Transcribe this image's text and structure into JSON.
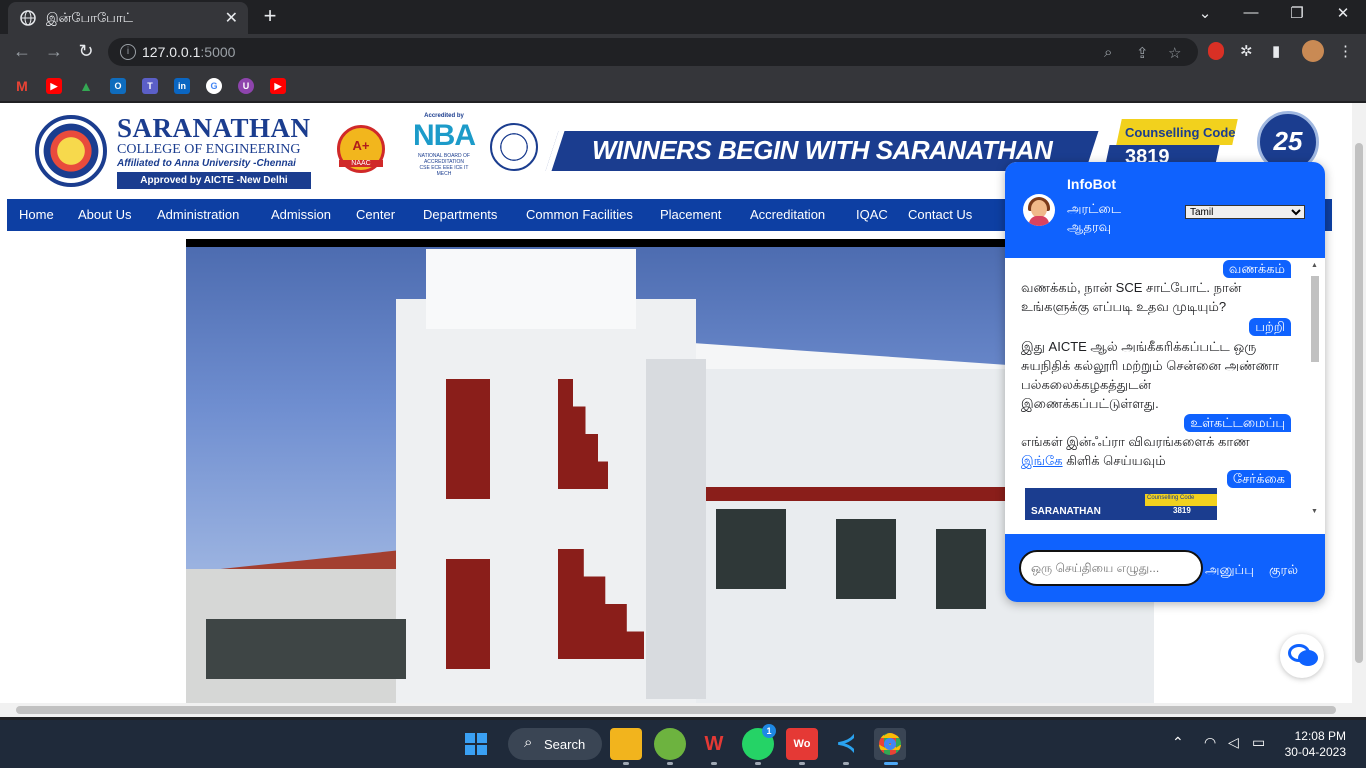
{
  "browser": {
    "tab_title": "இன்போபோட்",
    "close_tab": "✕",
    "new_tab": "+",
    "url_host": "127.0.0.1",
    "url_port": ":5000",
    "min": "⌄",
    "win_min": "—",
    "win_max": "❐",
    "win_close": "✕"
  },
  "site": {
    "college_name_line1": "SARANATHAN",
    "college_name_line2": "COLLEGE OF ENGINEERING",
    "affiliation": "Affiliated to Anna University  -Chennai",
    "approval": "Approved by AICTE -New Delhi",
    "naac_grade": "A+",
    "naac_label": "NAAC",
    "nba_accredited": "Accredited by",
    "nba_logo": "NBA",
    "nba_label": "NATIONAL BOARD OF ACCREDITATION",
    "nba_depts": "CSE ECE EEE ICE IT MECH",
    "banner_text": "WINNERS BEGIN WITH SARANATHAN",
    "counselling_label": "Counselling Code",
    "counselling_code": "3819",
    "anniversary": "25"
  },
  "menu": [
    {
      "label": "Home"
    },
    {
      "label": "About Us"
    },
    {
      "label": "Administration"
    },
    {
      "label": "Admission"
    },
    {
      "label": "Center"
    },
    {
      "label": "Departments"
    },
    {
      "label": "Common Facilities"
    },
    {
      "label": "Placement"
    },
    {
      "label": "Accreditation"
    },
    {
      "label": "IQAC"
    },
    {
      "label": "Contact Us"
    }
  ],
  "chatbot": {
    "title": "InfoBot",
    "subtitle": "அரட்டை ஆதரவு",
    "language_selected": "Tamil",
    "messages": [
      {
        "from": "user",
        "text": "வணக்கம்"
      },
      {
        "from": "bot",
        "text": " வணக்கம், நான் SCE சாட்போட். நான் உங்களுக்கு எப்படி உதவ முடியும்?"
      },
      {
        "from": "user",
        "text": "பற்றி"
      },
      {
        "from": "bot",
        "text": " இது AICTE ஆல் அங்கீகரிக்கப்பட்ட ஒரு சுயநிதிக் கல்லூரி மற்றும் சென்னை அண்ணா பல்கலைக்கழகத்துடன் இணைக்கப்பட்டுள்ளது."
      },
      {
        "from": "user",
        "text": "உள்கட்டமைப்பு"
      },
      {
        "from": "bot",
        "text_before": "எங்கள் இன்ஃப்ரா விவரங்களைக் காண  ",
        "link": "இங்கே",
        "text_after": "  கிளிக் செய்யவும்"
      },
      {
        "from": "user",
        "text": "சேர்க்கை"
      }
    ],
    "image_title": "SARANATHAN",
    "image_code_label": "Counselling Code",
    "image_code": "3819",
    "input_placeholder": "ஒரு செய்தியை எழுது...",
    "send_label": "அனுப்பு",
    "voice_label": "குரல்"
  },
  "taskbar": {
    "search_label": "Search",
    "time": "12:08 PM",
    "date": "30-04-2023",
    "whatsapp_badge": "1"
  },
  "colors": {
    "brand_blue": "#1b3d8f",
    "menu_blue": "#0d3fa3",
    "chat_blue": "#0f62fe"
  }
}
